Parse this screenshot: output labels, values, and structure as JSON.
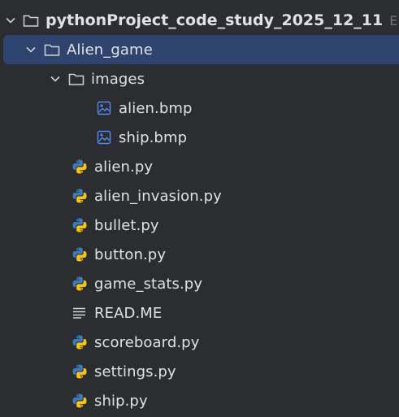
{
  "tree": {
    "root": {
      "label": "pythonProject_code_study_2025_12_11",
      "path_hint": "E:\\p",
      "icon": "folder-icon",
      "expanded": true
    },
    "alien_game": {
      "label": "Alien_game",
      "icon": "folder-icon",
      "expanded": true,
      "selected": true
    },
    "images": {
      "label": "images",
      "icon": "folder-icon",
      "expanded": true
    },
    "files": [
      {
        "label": "alien.bmp",
        "icon": "image-file-icon"
      },
      {
        "label": "ship.bmp",
        "icon": "image-file-icon"
      },
      {
        "label": "alien.py",
        "icon": "python-file-icon"
      },
      {
        "label": "alien_invasion.py",
        "icon": "python-file-icon"
      },
      {
        "label": "bullet.py",
        "icon": "python-file-icon"
      },
      {
        "label": "button.py",
        "icon": "python-file-icon"
      },
      {
        "label": "game_stats.py",
        "icon": "python-file-icon"
      },
      {
        "label": "READ.ME",
        "icon": "text-file-icon"
      },
      {
        "label": "scoreboard.py",
        "icon": "python-file-icon"
      },
      {
        "label": "settings.py",
        "icon": "python-file-icon"
      },
      {
        "label": "ship.py",
        "icon": "python-file-icon"
      }
    ]
  },
  "colors": {
    "background": "#2b2d30",
    "selection": "#2e436e",
    "text": "#dfe1e5",
    "muted": "#6f737a",
    "image_icon": "#548af7",
    "python_blue": "#3d7ab8",
    "python_yellow": "#f5c518"
  }
}
